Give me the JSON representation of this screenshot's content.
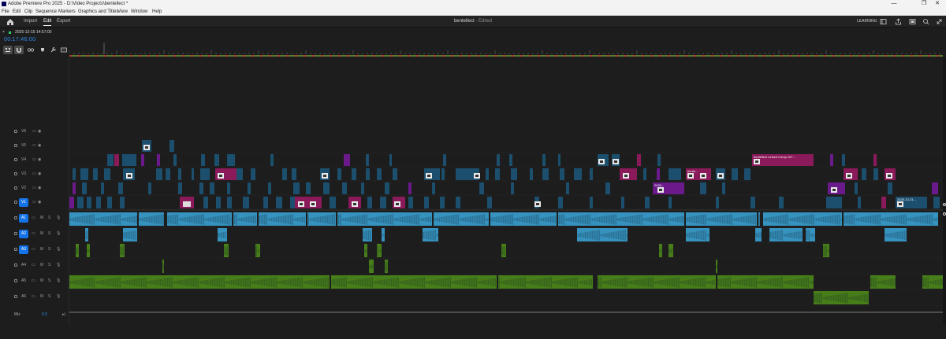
{
  "window": {
    "title": "Adobe Premiere Pro 2025 - D:\\Video Projects\\bentellect *",
    "controls": [
      "—",
      "❐",
      "✕"
    ]
  },
  "menu": [
    "File",
    "Edit",
    "Clip",
    "Sequence",
    "Markers",
    "Graphics and Titles",
    "View",
    "Window",
    "Help"
  ],
  "header": {
    "tabs": [
      "Import",
      "Edit",
      "Export"
    ],
    "active_tab": "Edit",
    "document_title": "bentellect",
    "document_status": " - Edited",
    "learning_label": "LEARNING",
    "icons": [
      "home-icon",
      "workspace-icon",
      "quick-export-icon",
      "fullscreen-icon",
      "search-icon",
      "collapse-icon"
    ]
  },
  "sequence": {
    "tab_name": "2025-12-15 14:57:00",
    "timecode": "00:17:46:00"
  },
  "tools": [
    "snap-icon",
    "linked-selection-icon",
    "ripple-icon",
    "marker-icon",
    "wrench-icon",
    "captions-icon"
  ],
  "tracks": {
    "video": [
      "V6",
      "V5",
      "V4",
      "V3",
      "V2",
      "V1"
    ],
    "audio": [
      "A1",
      "A2",
      "A3",
      "A4",
      "A5",
      "A6"
    ],
    "active_targets": [
      "V1",
      "A1",
      "A2",
      "A3"
    ],
    "audio_toggle_m": "M",
    "audio_toggle_s": "S",
    "mix_label": "Mix",
    "mix_value": "0.0"
  },
  "clip_labels": {
    "v4_comp": "bentellect Linked Comp 157...",
    "v3_bento": "bento...",
    "v2_2025": "2025...",
    "v1_end": "2025-12-21..."
  },
  "colors": {
    "video_teal": "#1c4f6e",
    "video_magenta": "#8a1a5a",
    "video_purple": "#6a1a8a",
    "audio_blue": "#3aa0d0",
    "audio_green": "#4d8a1a",
    "timecode": "#2d8ceb",
    "active_track": "#1473e6"
  }
}
